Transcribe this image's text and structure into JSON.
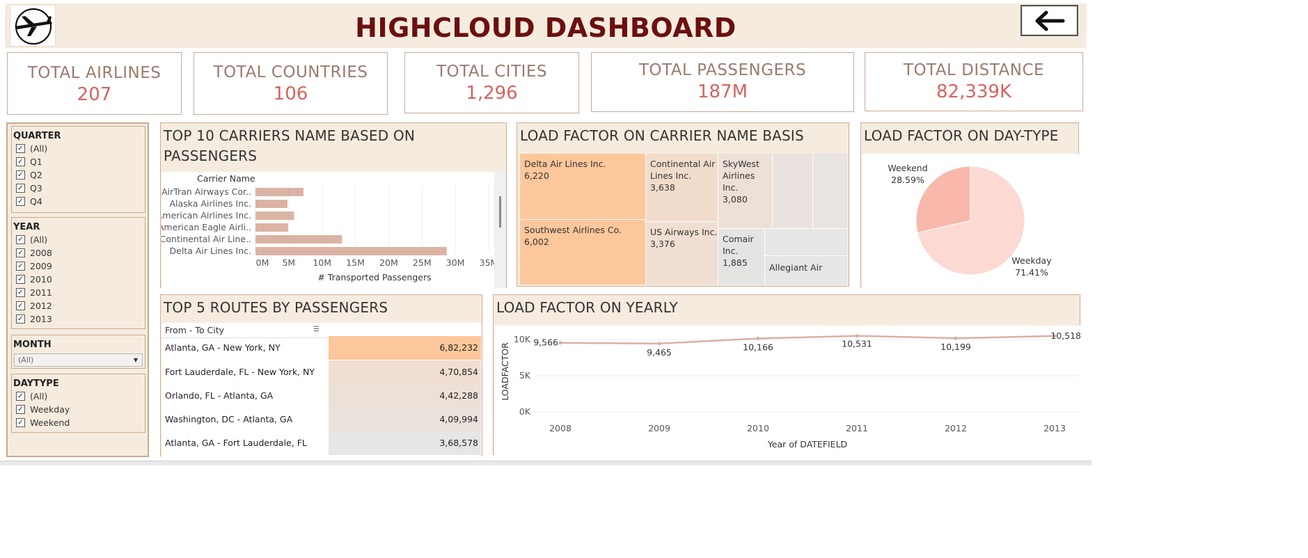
{
  "header": {
    "title": "HIGHCLOUD DASHBOARD",
    "back_icon": "arrow-left-icon",
    "logo_icon": "airplane-logo-icon"
  },
  "kpis": [
    {
      "label": "TOTAL AIRLINES",
      "value": "207"
    },
    {
      "label": "TOTAL COUNTRIES",
      "value": "106"
    },
    {
      "label": "TOTAL CITIES",
      "value": "1,296"
    },
    {
      "label": "TOTAL PASSENGERS",
      "value": "187M"
    },
    {
      "label": "TOTAL DISTANCE",
      "value": "82,339K"
    }
  ],
  "filters": {
    "quarter": {
      "title": "QUARTER",
      "options": [
        "(All)",
        "Q1",
        "Q2",
        "Q3",
        "Q4"
      ]
    },
    "year": {
      "title": "YEAR",
      "options": [
        "(All)",
        "2008",
        "2009",
        "2010",
        "2011",
        "2012",
        "2013"
      ]
    },
    "month": {
      "title": "MONTH",
      "selected": "(All)"
    },
    "daytype": {
      "title": "DAYTYPE",
      "options": [
        "(All)",
        "Weekday",
        "Weekend"
      ]
    }
  },
  "carriers_panel": {
    "title_line1": "TOP 10 CARRIERS NAME BASED ON",
    "title_line2": "PASSENGERS",
    "header": "Carrier Name",
    "xlabel": "# Transported Passengers"
  },
  "treemap_panel": {
    "title": "LOAD FACTOR ON CARRIER NAME BASIS",
    "cells": [
      {
        "name": "Delta Air Lines Inc.",
        "value": "6,220"
      },
      {
        "name": "Southwest Airlines Co.",
        "value": "6,002"
      },
      {
        "name": "Continental Air Lines Inc.",
        "value": "3,638"
      },
      {
        "name": "US Airways Inc.",
        "value": "3,376"
      },
      {
        "name": "SkyWest Airlines Inc.",
        "value": "3,080"
      },
      {
        "name": "Comair Inc.",
        "value": "1,885"
      },
      {
        "name": "Allegiant Air",
        "value": ""
      }
    ]
  },
  "daytype_panel": {
    "title": "LOAD FACTOR ON DAY-TYPE",
    "slices": [
      {
        "label": "Weekday",
        "pct_text": "71.41%",
        "pct": 71.41,
        "color": "#fcd9d3"
      },
      {
        "label": "Weekend",
        "pct_text": "28.59%",
        "pct": 28.59,
        "color": "#f8b8ac"
      }
    ]
  },
  "routes_panel": {
    "title": "TOP 5 ROUTES BY PASSENGERS",
    "header": "From - To City",
    "rows": [
      {
        "route": "Atlanta, GA - New York, NY",
        "value": "6,82,232",
        "color": "#fcc79a"
      },
      {
        "route": "Fort Lauderdale, FL - New York, NY",
        "value": "4,70,854",
        "color": "#f0dfd1"
      },
      {
        "route": "Orlando, FL - Atlanta, GA",
        "value": "4,42,288",
        "color": "#ede0d6"
      },
      {
        "route": "Washington, DC - Atlanta, GA",
        "value": "4,09,994",
        "color": "#ebe2dc"
      },
      {
        "route": "Atlanta, GA - Fort Lauderdale, FL",
        "value": "3,68,578",
        "color": "#e6e6e6"
      }
    ]
  },
  "yearly_panel": {
    "title": "LOAD FACTOR ON YEARLY"
  },
  "chart_data": [
    {
      "type": "bar",
      "orientation": "horizontal",
      "categories": [
        "AirTran Airways Cor..",
        "Alaska Airlines Inc.",
        "American Airlines Inc.",
        "American Eagle Airli..",
        "Continental Air Line..",
        "Delta Air Lines Inc."
      ],
      "values": [
        7.2,
        4.8,
        5.8,
        4.9,
        13.0,
        28.7
      ],
      "xlabel": "# Transported Passengers",
      "ylabel": "Carrier Name",
      "xlim": [
        0,
        35
      ],
      "xticks": [
        "0M",
        "5M",
        "10M",
        "15M",
        "20M",
        "25M",
        "30M",
        "35M"
      ],
      "color": "#dbb3a4",
      "grid": true
    },
    {
      "type": "line",
      "x": [
        "2008",
        "2009",
        "2010",
        "2011",
        "2012",
        "2013"
      ],
      "values": [
        9566,
        9465,
        10166,
        10531,
        10199,
        10518
      ],
      "labels": [
        "9,566",
        "9,465",
        "10,166",
        "10,531",
        "10,199",
        "10,518"
      ],
      "xlabel": "Year of DATEFIELD",
      "ylabel": "LOADFACTOR",
      "ylim": [
        0,
        10600
      ],
      "yticks": [
        "0K",
        "5K",
        "10K"
      ],
      "color": "#d8b0a6",
      "grid": true
    }
  ]
}
